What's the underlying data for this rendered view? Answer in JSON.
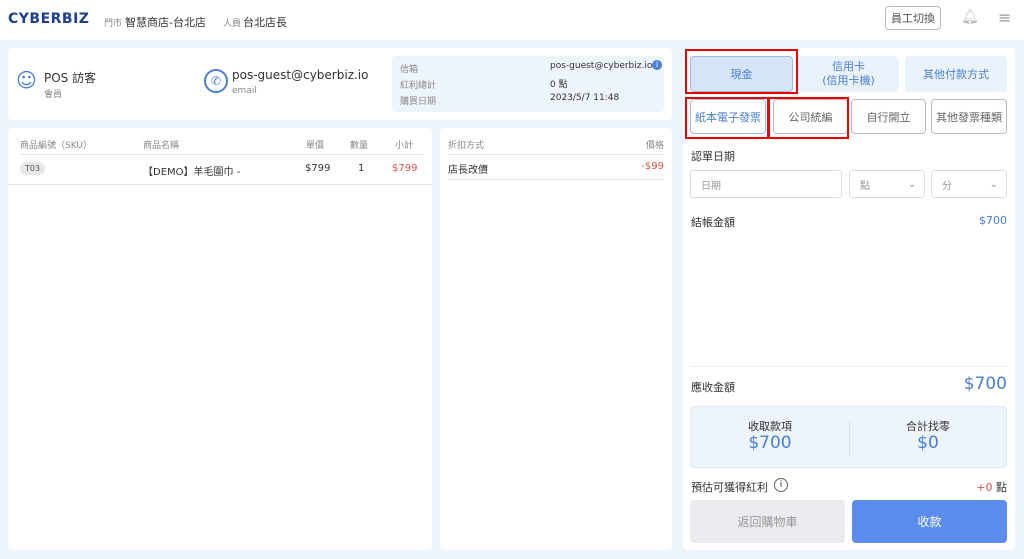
{
  "header": {
    "logo": "CYBERBIZ",
    "store_label": "門市",
    "store": "智慧商店-台北店",
    "staff_label": "人員",
    "staff": "台北店長",
    "switch_staff": "員工切換"
  },
  "customer": {
    "name": "POS 訪客",
    "role": "會員",
    "contact": "pos-guest@cyberbiz.io",
    "contact_type": "email",
    "info": [
      {
        "label": "信箱",
        "value": "pos-guest@cyberbiz.io"
      },
      {
        "label": "紅利總計",
        "value": "0 點"
      },
      {
        "label": "購買日期",
        "value": "2023/5/7 11:48"
      }
    ]
  },
  "items": {
    "headers": [
      "商品編號（SKU）",
      "商品名稱",
      "單價",
      "數量",
      "小計"
    ],
    "rows": [
      {
        "sku": "T03",
        "name": "【DEMO】羊毛圍巾 -",
        "price": "$799",
        "qty": "1",
        "subtotal": "$799"
      }
    ]
  },
  "discounts": {
    "headers": [
      "折扣方式",
      "價格"
    ],
    "rows": [
      {
        "name": "店長改價",
        "price": "-$99"
      }
    ]
  },
  "payment": {
    "methods": [
      "現金",
      "信用卡\n(信用卡機)",
      "其他付款方式"
    ],
    "selected": "現金",
    "invoice_types": [
      "紙本電子發票",
      "公司統編",
      "自行開立",
      "其他發票種類"
    ],
    "selected_invoice": "紙本電子發票",
    "date_label": "認單日期",
    "date_placeholder": "日期",
    "hour_placeholder": "點",
    "minute_placeholder": "分",
    "checkout_label": "結帳金額",
    "checkout_amount": "$700",
    "receivable_label": "應收金額",
    "receivable_amount": "$700",
    "received_label": "收取款項",
    "received_amount": "$700",
    "change_label": "合計找零",
    "change_amount": "$0",
    "bonus_label": "預估可獲得紅利",
    "bonus_value": "+0",
    "bonus_unit": "點",
    "back_button": "返回購物車",
    "collect_button": "收款"
  },
  "colors": {
    "accent": "#4a7fd6",
    "primary_button": "#5b8def",
    "negative": "#d9534f",
    "highlight": "#e00000"
  }
}
